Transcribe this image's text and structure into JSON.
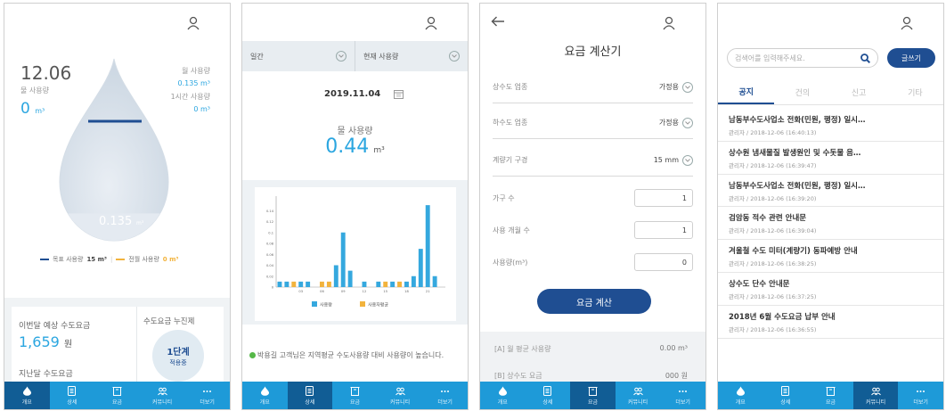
{
  "tabbar": [
    {
      "label": "개요",
      "icon": "water-drop-icon"
    },
    {
      "label": "상세",
      "icon": "document-icon"
    },
    {
      "label": "요금",
      "icon": "bill-icon"
    },
    {
      "label": "커뮤니티",
      "icon": "community-icon"
    },
    {
      "label": "더보기",
      "icon": "more-icon"
    }
  ],
  "overview": {
    "usage_big": "12.06",
    "usage_label": "물 사용량",
    "usage_value": "0",
    "usage_unit": "m³",
    "monthly_label": "월 사용량",
    "monthly_value": "0.135 m³",
    "hourly_label": "1시간 사용량",
    "hourly_value": "0 m³",
    "drop_value": "0.135",
    "drop_unit": "m³",
    "drop_fill_ratio": 0.15,
    "legend_target_label": "목표 사용량",
    "legend_target_value": "15 m³",
    "legend_prev_label": "전월 사용량",
    "legend_prev_value": "0 m³",
    "bill_label": "이번달 예상 수도요금",
    "bill_value": "1,659",
    "bill_unit": "원",
    "last_bill_label": "지난달 수도요금",
    "progressive_label": "수도요금 누진제",
    "progressive_stage": "1단계",
    "progressive_status": "적용중",
    "colors": {
      "accent": "#2ba6e0",
      "target": "#1f4e92",
      "prev": "#f2b33d"
    }
  },
  "detail": {
    "period": "일간",
    "mode": "현재 사용량",
    "date": "2019.11.04",
    "usage_label": "물 사용량",
    "usage_value": "0.44",
    "usage_unit": "m³",
    "notice": "박용길 고객님은 지역평균 수도사용량 대비 사용량이 높습니다."
  },
  "calculator": {
    "title": "요금 계산기",
    "rows": [
      {
        "label": "상수도 업종",
        "value": "가정용"
      },
      {
        "label": "하수도 업종",
        "value": "가정용"
      },
      {
        "label": "계량기 구경",
        "value": "15 mm"
      }
    ],
    "inputs": [
      {
        "label": "가구 수",
        "value": "1"
      },
      {
        "label": "사용 개월 수",
        "value": "1"
      },
      {
        "label": "사용량(m³)",
        "value": "0"
      }
    ],
    "calc_button": "요금 계산",
    "result_a_label": "[A] 월 평균 사용량",
    "result_a_value": "0.00 m³",
    "result_b_label": "[B] 상수도 요금",
    "result_b_value": "000 원"
  },
  "community": {
    "search_placeholder": "검색어를 입력해주세요.",
    "write_button": "글쓰기",
    "tabs": [
      "공지",
      "건의",
      "신고",
      "기타"
    ],
    "posts": [
      {
        "title": "남동부수도사업소 전화(민원, 행정) 일시…",
        "meta": "관리자 / 2018-12-06 (16:40:13)"
      },
      {
        "title": "상수원 냄새물질 발생원인 및 수돗물 음…",
        "meta": "관리자 / 2018-12-06 (16:39:47)"
      },
      {
        "title": "남동부수도사업소 전화(민원, 행정) 일시…",
        "meta": "관리자 / 2018-12-06 (16:39:20)"
      },
      {
        "title": "검암동 적수 관련 안내문",
        "meta": "관리자 / 2018-12-06 (16:39:04)"
      },
      {
        "title": "겨울철 수도 미터(계량기) 동파예방 안내",
        "meta": "관리자 / 2018-12-06 (16:38:25)"
      },
      {
        "title": "상수도 단수 안내문",
        "meta": "관리자 / 2018-12-06 (16:37:25)"
      },
      {
        "title": "2018년 6월 수도요금 납부 안내",
        "meta": "관리자 / 2018-12-06 (16:36:55)"
      }
    ]
  },
  "chart_data": {
    "type": "bar",
    "categories": [
      "00",
      "01",
      "02",
      "03",
      "04",
      "05",
      "06",
      "07",
      "08",
      "09",
      "10",
      "11",
      "12",
      "13",
      "14",
      "15",
      "16",
      "17",
      "18",
      "19",
      "20",
      "21",
      "22",
      "23"
    ],
    "series": [
      {
        "name": "사용량",
        "values": [
          0.01,
          0.01,
          0,
          0.01,
          0.01,
          0,
          0,
          0,
          0.04,
          0.1,
          0.03,
          0,
          0.01,
          0,
          0.01,
          0,
          0.01,
          0,
          0.01,
          0.02,
          0.07,
          0.15,
          0.02,
          0
        ]
      },
      {
        "name": "사용자평균",
        "values": [
          0,
          0,
          0.01,
          0,
          0,
          0,
          0.01,
          0.01,
          0,
          0,
          0,
          0,
          0,
          0,
          0,
          0.01,
          0,
          0.01,
          0,
          0,
          0,
          0,
          0,
          0
        ]
      }
    ],
    "x_tick_labels": [
      "03",
      "06",
      "09",
      "12",
      "15",
      "18",
      "21"
    ],
    "y_tick_labels": [
      "0",
      "0.02",
      "0.04",
      "0.06",
      "0.08",
      "0.1",
      "0.12",
      "0.14"
    ],
    "ylim": [
      0,
      0.16
    ],
    "legend_position": "bottom",
    "colors": [
      "#35a8de",
      "#f2b33d"
    ]
  }
}
